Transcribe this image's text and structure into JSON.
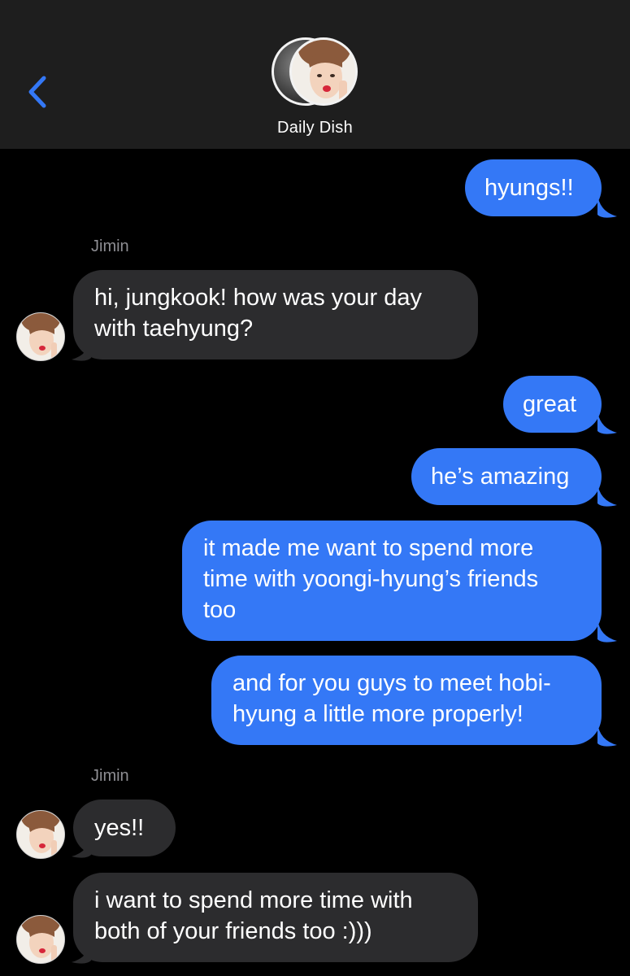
{
  "header": {
    "title": "Daily Dish",
    "back_icon": "chevron-left-icon",
    "accent_color": "#3478f6"
  },
  "messages": [
    {
      "direction": "out",
      "text": "hyungs!!"
    },
    {
      "direction": "in",
      "sender": "Jimin",
      "text_lines": [
        "hi, jungkook! how was your day",
        "with taehyung?"
      ]
    },
    {
      "direction": "out",
      "text": "great"
    },
    {
      "direction": "out",
      "text": "he’s amazing"
    },
    {
      "direction": "out",
      "text_lines": [
        "it made me want to spend more",
        "time with yoongi-hyung’s friends",
        "too"
      ]
    },
    {
      "direction": "out",
      "text_lines": [
        "and for you guys to meet hobi-",
        "hyung a little more properly!"
      ]
    },
    {
      "direction": "in",
      "sender": "Jimin",
      "text": "yes!!"
    },
    {
      "direction": "in",
      "text_lines": [
        "i want to spend more time with",
        "both of your friends too :)))"
      ]
    }
  ],
  "colors": {
    "outgoing_bubble": "#3478f6",
    "incoming_bubble": "#2c2c2e",
    "background": "#000000",
    "header_bg": "#1e1e1e",
    "sender_label": "#8e8e93"
  }
}
